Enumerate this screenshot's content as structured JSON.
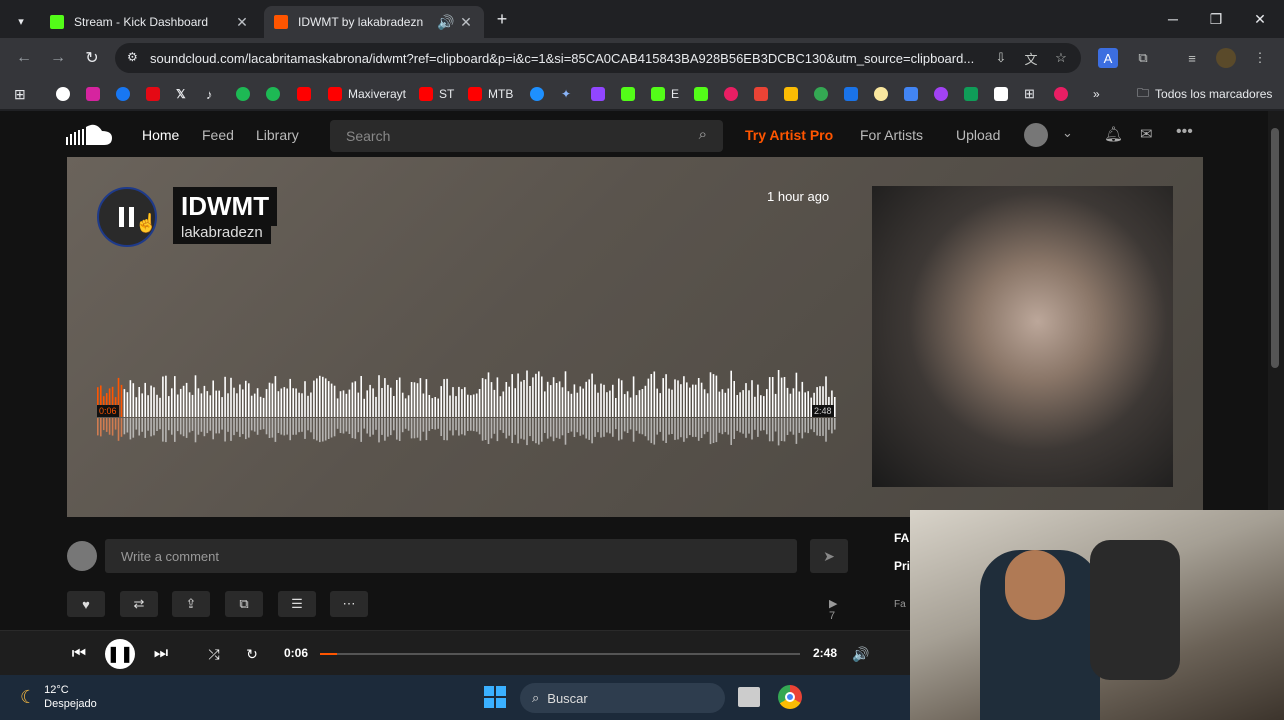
{
  "tabs": [
    {
      "title": "Stream - Kick Dashboard",
      "favicon_color": "#53fc18",
      "active": false
    },
    {
      "title": "IDWMT by lakabradezn",
      "favicon_color": "#ff5500",
      "active": true
    }
  ],
  "toolbar": {
    "url": "soundcloud.com/lacabritamaskabrona/idwmt?ref=clipboard&p=i&c=1&si=85CA0CAB415843BA928B56EB3DCBC130&utm_source=clipboard..."
  },
  "bookmarks": {
    "items": [
      {
        "label": "Maxiverayt",
        "color": "#ff0000"
      },
      {
        "label": "ST",
        "color": "#ff0000"
      },
      {
        "label": "MTB",
        "color": "#ff0000"
      },
      {
        "label": "E",
        "color": "#53fc18"
      }
    ],
    "all_label": "Todos los marcadores"
  },
  "soundcloud": {
    "nav": {
      "home": "Home",
      "feed": "Feed",
      "library": "Library"
    },
    "search_placeholder": "Search",
    "try_pro": "Try Artist Pro",
    "for_artists": "For Artists",
    "upload": "Upload"
  },
  "track": {
    "title": "IDWMT",
    "artist": "lakabradezn",
    "posted": "1 hour ago",
    "elapsed": "0:06",
    "duration": "2:48",
    "progress_fraction": 0.036
  },
  "comment": {
    "placeholder": "Write a comment"
  },
  "stats": {
    "plays": "7"
  },
  "sidebar_text": "FA",
  "sidebar_text2": "Pri",
  "sidebar_text3": "Fa",
  "player": {
    "elapsed": "0:06",
    "duration": "2:48"
  },
  "taskbar": {
    "temp": "12°C",
    "condition": "Despejado",
    "search": "Buscar"
  },
  "colors": {
    "accent": "#ff5500",
    "try_pro": "#ff5500"
  }
}
